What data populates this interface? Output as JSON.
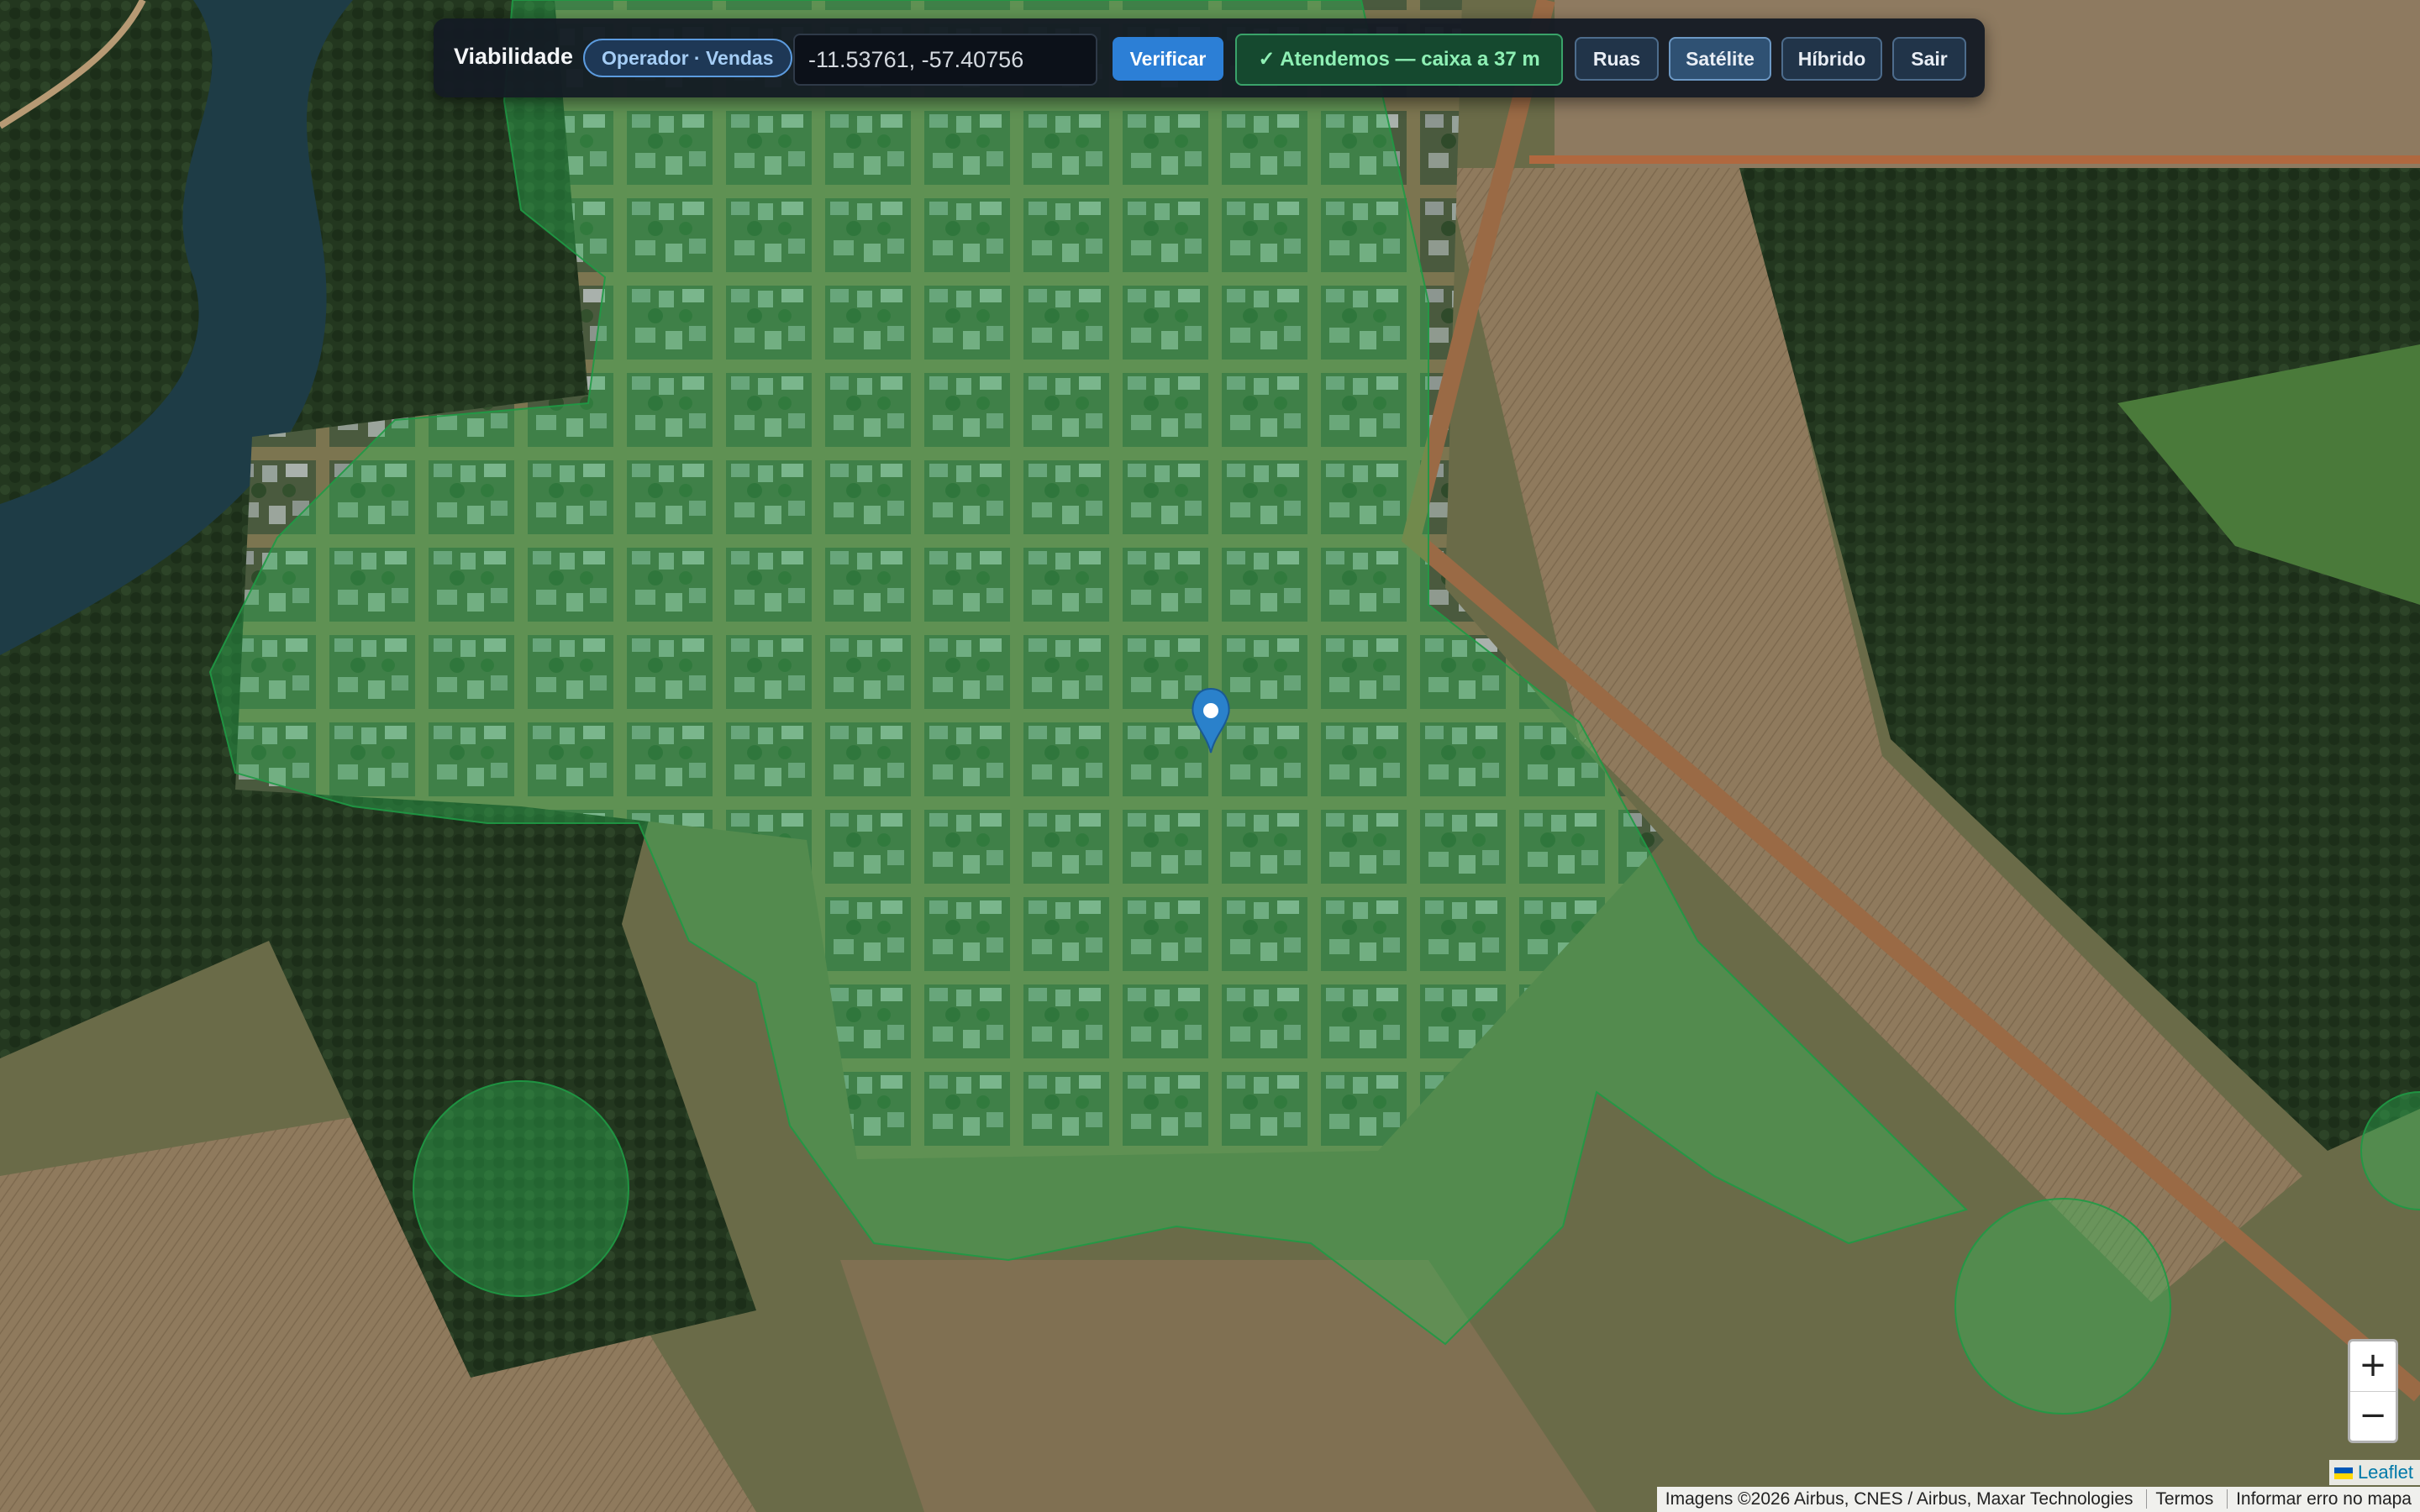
{
  "toolbar": {
    "title": "Viabilidade",
    "role_badge": "Operador · Vendas",
    "coordinates_value": "-11.53761, -57.40756",
    "verify_label": "Verificar",
    "status": "✓ Atendemos — caixa a 37 m",
    "layer_streets": "Ruas",
    "layer_satellite": "Satélite",
    "layer_hybrid": "Híbrido",
    "logout_label": "Sair",
    "active_layer": "Satélite"
  },
  "map": {
    "basemap": "satellite",
    "coverage_color": "#2fc05a",
    "marker": "location-pin-icon",
    "marker_color": "#2a81cb"
  },
  "zoom": {
    "in": "+",
    "out": "−"
  },
  "attribution": {
    "leaflet": "Leaflet",
    "imagery": "Imagens ©2026 Airbus, CNES / Airbus, Maxar Technologies",
    "terms": "Termos",
    "report": "Informar erro no mapa"
  },
  "colors": {
    "toolbar_bg": "#141a24",
    "accent": "#2c7fd6",
    "success": "#3aa36a"
  }
}
